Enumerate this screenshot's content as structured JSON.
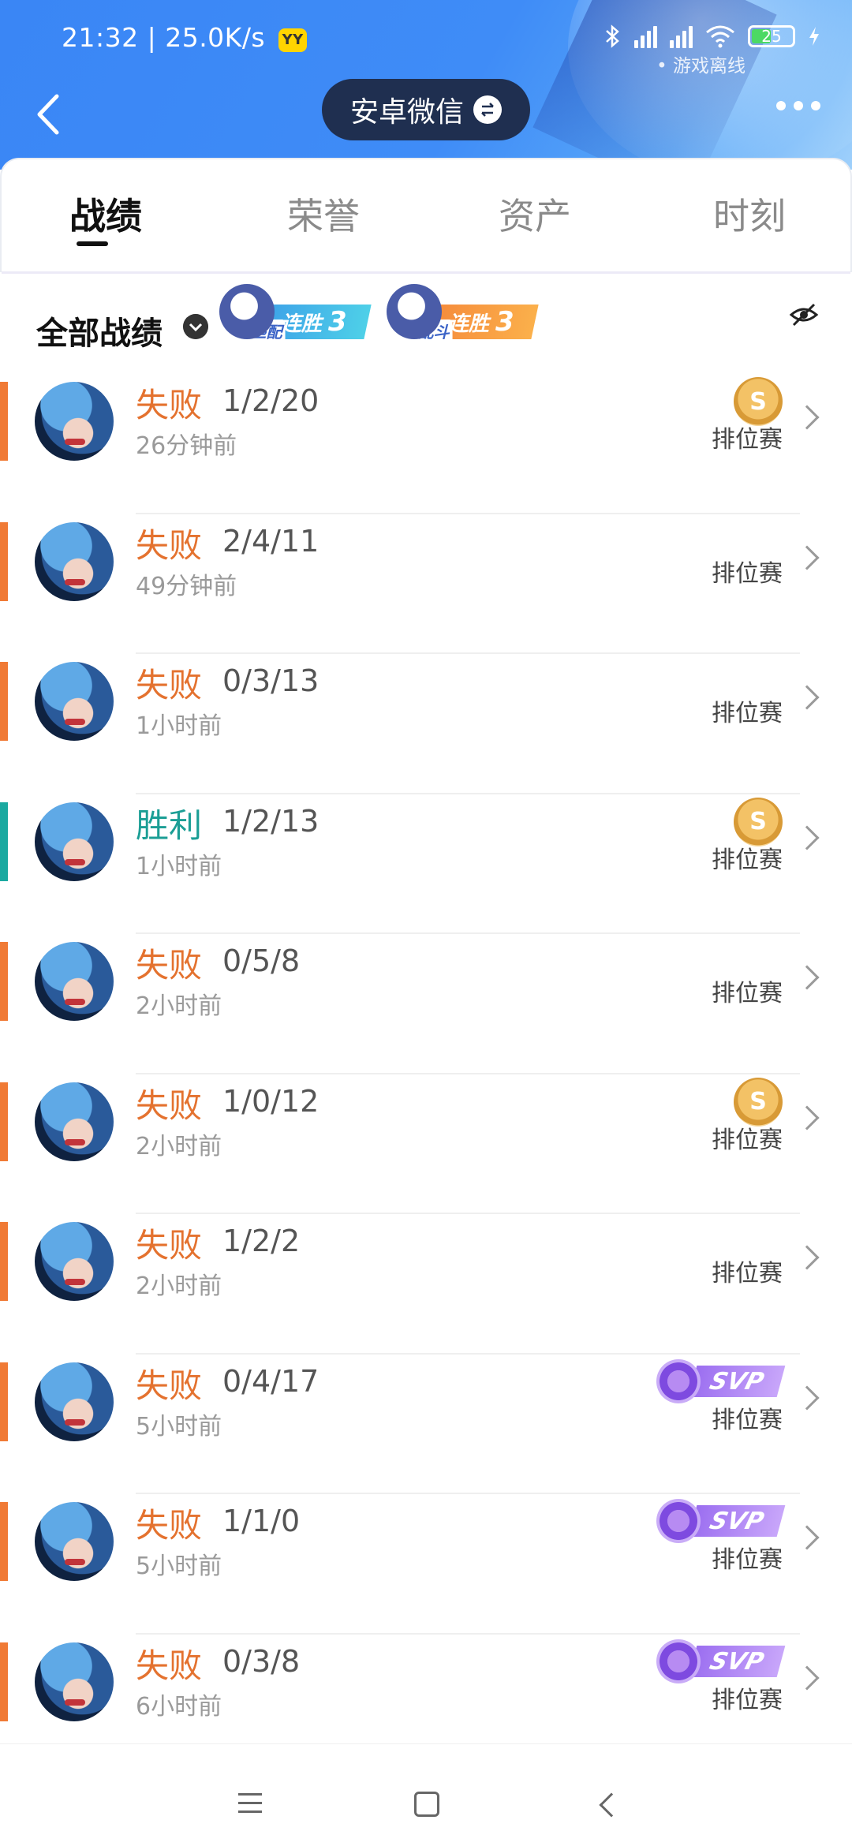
{
  "status_bar": {
    "time_speed": "21:32 | 25.0K/s",
    "vpn_badge": "YY",
    "battery": "25",
    "game_status": "• 游戏离线"
  },
  "header": {
    "account": "安卓微信"
  },
  "tabs": [
    {
      "label": "战绩",
      "active": true
    },
    {
      "label": "荣誉",
      "active": false
    },
    {
      "label": "资产",
      "active": false
    },
    {
      "label": "时刻",
      "active": false
    }
  ],
  "filter": {
    "label": "全部战绩",
    "streaks": [
      {
        "mode": "匹配",
        "text": "连胜",
        "count": "3"
      },
      {
        "mode": "乱斗",
        "text": "连胜",
        "count": "3"
      }
    ]
  },
  "records": [
    {
      "result": "失败",
      "kda": "1/2/20",
      "time": "26分钟前",
      "mode": "排位赛",
      "badge": "S"
    },
    {
      "result": "失败",
      "kda": "2/4/11",
      "time": "49分钟前",
      "mode": "排位赛",
      "badge": ""
    },
    {
      "result": "失败",
      "kda": "0/3/13",
      "time": "1小时前",
      "mode": "排位赛",
      "badge": ""
    },
    {
      "result": "胜利",
      "kda": "1/2/13",
      "time": "1小时前",
      "mode": "排位赛",
      "badge": "S"
    },
    {
      "result": "失败",
      "kda": "0/5/8",
      "time": "2小时前",
      "mode": "排位赛",
      "badge": ""
    },
    {
      "result": "失败",
      "kda": "1/0/12",
      "time": "2小时前",
      "mode": "排位赛",
      "badge": "S"
    },
    {
      "result": "失败",
      "kda": "1/2/2",
      "time": "2小时前",
      "mode": "排位赛",
      "badge": ""
    },
    {
      "result": "失败",
      "kda": "0/4/17",
      "time": "5小时前",
      "mode": "排位赛",
      "badge": "SVP"
    },
    {
      "result": "失败",
      "kda": "1/1/0",
      "time": "5小时前",
      "mode": "排位赛",
      "badge": "SVP"
    },
    {
      "result": "失败",
      "kda": "0/3/8",
      "time": "6小时前",
      "mode": "排位赛",
      "badge": "SVP"
    }
  ],
  "colors": {
    "loss": "#e4722f",
    "win": "#1b9e95",
    "header_blue": "#3a86f5"
  }
}
